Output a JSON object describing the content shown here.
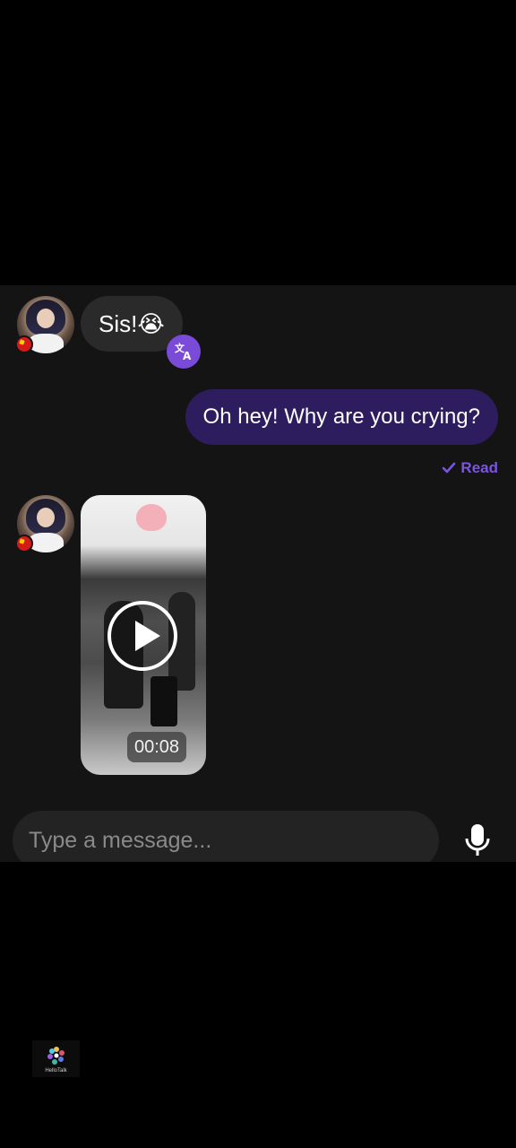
{
  "messages": {
    "incoming_1": {
      "text": "Sis!😭"
    },
    "outgoing_1": {
      "text": "Oh hey! Why are you crying?"
    },
    "read_status": "Read",
    "video": {
      "duration": "00:08"
    }
  },
  "translate_icon": "translate-icon",
  "composer": {
    "placeholder": "Type a message...",
    "mic_icon": "microphone-icon"
  },
  "watermark": {
    "label": "HelloTalk"
  },
  "colors": {
    "outgoing_bubble": "#2d1d5e",
    "incoming_bubble": "#2a2a2a",
    "accent": "#7a4bd8",
    "read_status": "#7b55e0",
    "background": "#141414"
  }
}
